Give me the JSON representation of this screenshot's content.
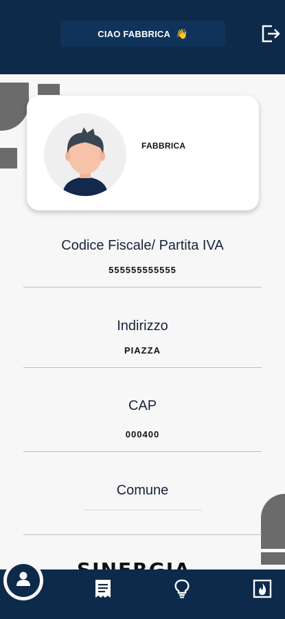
{
  "header": {
    "greeting": "CIAO FABBRICA",
    "greeting_icon": "waving-hand-icon",
    "logout_icon": "logout-icon"
  },
  "profile": {
    "name": "FABBRICA",
    "avatar_icon": "user-avatar"
  },
  "fields": [
    {
      "label": "Codice Fiscale/ Partita IVA",
      "value": "555555555555"
    },
    {
      "label": "Indirizzo",
      "value": "PIAZZA"
    },
    {
      "label": "CAP",
      "value": "000400"
    },
    {
      "label": "Comune",
      "value": ""
    }
  ],
  "logo": {
    "text": "SINERGIA"
  },
  "nav": {
    "items": [
      {
        "icon": "profile-icon",
        "active": true
      },
      {
        "icon": "receipt-icon",
        "active": false
      },
      {
        "icon": "lightbulb-icon",
        "active": false
      },
      {
        "icon": "fire-icon",
        "active": false
      }
    ]
  },
  "colors": {
    "primary": "#0d2a4b",
    "background": "#f7f7f7",
    "decoration": "#6b6b6b"
  }
}
